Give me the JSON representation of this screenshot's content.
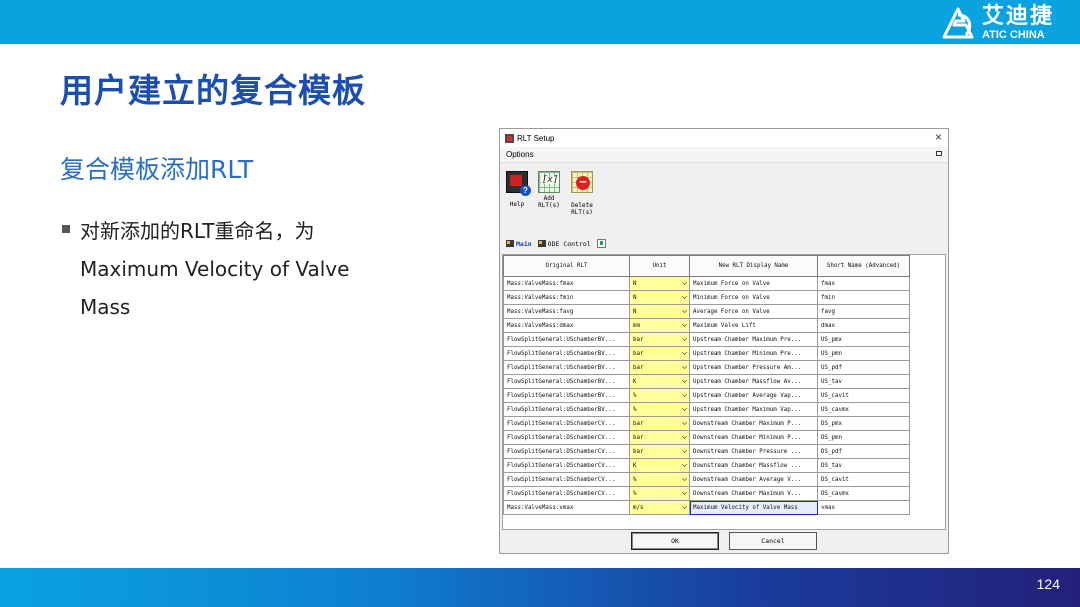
{
  "brand": {
    "name_cn": "艾迪捷",
    "name_en": "ATIC CHINA"
  },
  "slide": {
    "title": "用户建立的复合模板",
    "subtitle": "复合模板添加RLT",
    "bullet": "对新添加的RLT重命名，为Maximum Velocity of Valve Mass",
    "page_number": "124"
  },
  "colors": {
    "top_bar": "#0aa3e0",
    "title": "#1a4fb0",
    "subtitle": "#2a6dc9",
    "unit_cell": "#ffff9a"
  },
  "dialog": {
    "title": "RLT Setup",
    "menu": "Options",
    "toolbar": {
      "help": {
        "label": "Help",
        "icon": "help-icon"
      },
      "add": {
        "label_line1": "Add",
        "label_line2": "RLT(s)",
        "icon": "add-rlt-icon"
      },
      "delete": {
        "label_line1": "Delete",
        "label_line2": "RLT(s)",
        "icon": "delete-rlt-icon"
      }
    },
    "tabs": [
      {
        "label": "Main",
        "active": true
      },
      {
        "label": "ODE Control",
        "active": false
      }
    ],
    "columns": [
      "Original RLT",
      "Unit",
      "New RLT Display Name",
      "Short Name (Advanced)"
    ],
    "rows": [
      {
        "original": "Mass:ValveMass:fmax",
        "unit": "N",
        "display": "Maximum Force on Valve",
        "short": "fmax"
      },
      {
        "original": "Mass:ValveMass:fmin",
        "unit": "N",
        "display": "Minimum Force on Valve",
        "short": "fmin"
      },
      {
        "original": "Mass:ValveMass:favg",
        "unit": "N",
        "display": "Average Force on Valve",
        "short": "favg"
      },
      {
        "original": "Mass:ValveMass:dmax",
        "unit": "mm",
        "display": "Maximum Valve Lift",
        "short": "dmax"
      },
      {
        "original": "FlowSplitGeneral:USchamberBV...",
        "unit": "bar",
        "display": "Upstream Chamber Maximum Pre...",
        "short": "US_pmx"
      },
      {
        "original": "FlowSplitGeneral:USchamberBV...",
        "unit": "bar",
        "display": "Upstream Chamber Minimum Pre...",
        "short": "US_pmn"
      },
      {
        "original": "FlowSplitGeneral:USchamberBV...",
        "unit": "bar",
        "display": "Upstream Chamber Pressure Am...",
        "short": "US_pdf"
      },
      {
        "original": "FlowSplitGeneral:USchamberBV...",
        "unit": "K",
        "display": "Upstream Chamber Massflow Av...",
        "short": "US_tav"
      },
      {
        "original": "FlowSplitGeneral:USchamberBV...",
        "unit": "%",
        "display": "Upstream Chamber Average Vap...",
        "short": "US_cavit"
      },
      {
        "original": "FlowSplitGeneral:USchamberBV...",
        "unit": "%",
        "display": "Upstream Chamber Maximum Vap...",
        "short": "US_cavmx"
      },
      {
        "original": "FlowSplitGeneral:DSchamberCV...",
        "unit": "bar",
        "display": "Downstream Chamber Maximum P...",
        "short": "DS_pmx"
      },
      {
        "original": "FlowSplitGeneral:DSchamberCV...",
        "unit": "bar",
        "display": "Downstream Chamber Minimum P...",
        "short": "DS_pmn"
      },
      {
        "original": "FlowSplitGeneral:DSchamberCV...",
        "unit": "bar",
        "display": "Downstream Chamber Pressure ...",
        "short": "DS_pdf"
      },
      {
        "original": "FlowSplitGeneral:DSchamberCV...",
        "unit": "K",
        "display": "Downstream Chamber Massflow ...",
        "short": "DS_tav"
      },
      {
        "original": "FlowSplitGeneral:DSchamberCV...",
        "unit": "%",
        "display": "Downstream Chamber Average V...",
        "short": "DS_cavit"
      },
      {
        "original": "FlowSplitGeneral:DSchamberCV...",
        "unit": "%",
        "display": "Downstream Chamber Maximum V...",
        "short": "DS_cavmx"
      },
      {
        "original": "Mass:ValveMass:vmax",
        "unit": "m/s",
        "display": "Maximum Velocity of Valve Mass",
        "short": "vmax",
        "selected": true
      }
    ],
    "buttons": {
      "ok": "OK",
      "cancel": "Cancel"
    }
  }
}
